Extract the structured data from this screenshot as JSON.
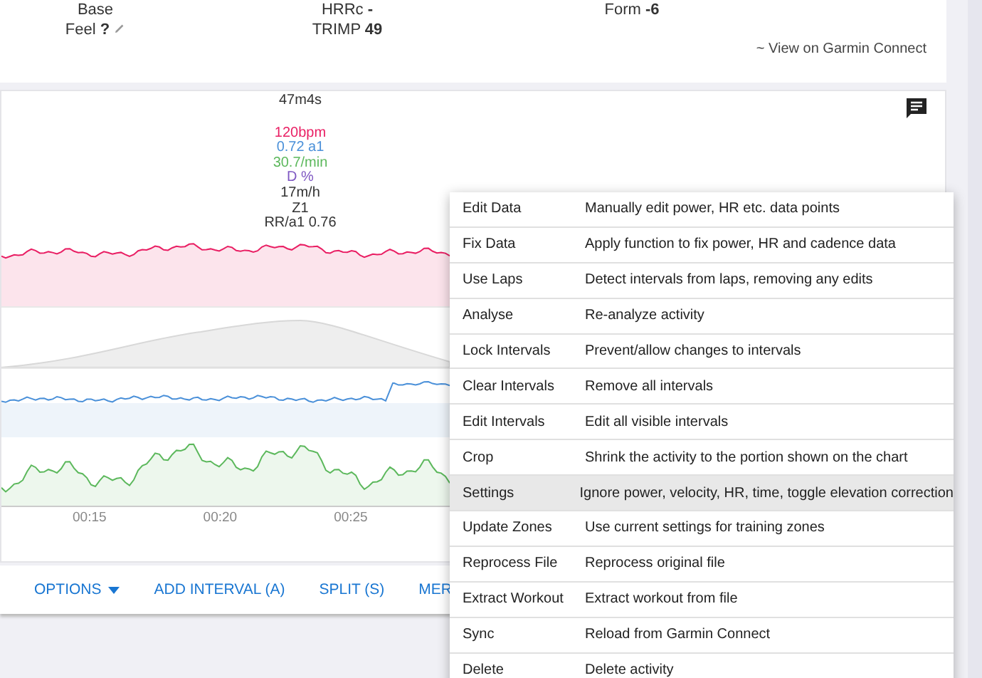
{
  "summary": {
    "row_1": [
      {
        "label": "Base"
      },
      {
        "label": "HRRc",
        "value": "-"
      },
      {
        "label": "Form",
        "value": "-6"
      }
    ],
    "feel": {
      "label": "Feel",
      "value": "?"
    },
    "trimp": {
      "label": "TRIMP",
      "value": "49"
    },
    "link": "~ View on Garmin Connect"
  },
  "chart": {
    "time": "47m4s",
    "readings": [
      {
        "text": "120bpm",
        "color": "#e91e63"
      },
      {
        "text": "0.72 a1",
        "color": "#4a90d9"
      },
      {
        "text": "30.7/min",
        "color": "#5cb85c"
      },
      {
        "text": "D %",
        "color": "#7e57c2"
      },
      {
        "text": "17m/h",
        "color": "#333333"
      },
      {
        "text": "Z1",
        "color": "#333333"
      },
      {
        "text": "RR/a1 0.76",
        "color": "#333333"
      }
    ],
    "x_axis": [
      "00:15",
      "00:20",
      "00:25"
    ]
  },
  "toolbar": {
    "options": "OPTIONS",
    "buttons": [
      "ADD INTERVAL (A)",
      "SPLIT (S)",
      "MER"
    ]
  },
  "menu": [
    {
      "label": "Edit Data",
      "description": "Manually edit power, HR etc. data points",
      "selected": false
    },
    {
      "label": "Fix Data",
      "description": "Apply function to fix power, HR and cadence data",
      "selected": false
    },
    {
      "label": "Use Laps",
      "description": "Detect intervals from laps, removing any edits",
      "selected": false
    },
    {
      "label": "Analyse",
      "description": "Re-analyze activity",
      "selected": false
    },
    {
      "label": "Lock Intervals",
      "description": "Prevent/allow changes to intervals",
      "selected": false
    },
    {
      "label": "Clear Intervals",
      "description": "Remove all intervals",
      "selected": false
    },
    {
      "label": "Edit Intervals",
      "description": "Edit all visible intervals",
      "selected": false
    },
    {
      "label": "Crop",
      "description": "Shrink the activity to the portion shown on the chart",
      "selected": false
    },
    {
      "label": "Settings",
      "description": "Ignore power, velocity, HR, time, toggle elevation correction",
      "selected": true
    },
    {
      "label": "Update Zones",
      "description": "Use current settings for training zones",
      "selected": false
    },
    {
      "label": "Reprocess File",
      "description": "Reprocess original file",
      "selected": false
    },
    {
      "label": "Extract Workout",
      "description": "Extract workout from file",
      "selected": false
    },
    {
      "label": "Sync",
      "description": "Reload from Garmin Connect",
      "selected": false
    },
    {
      "label": "Delete",
      "description": "Delete activity",
      "selected": false
    }
  ]
}
